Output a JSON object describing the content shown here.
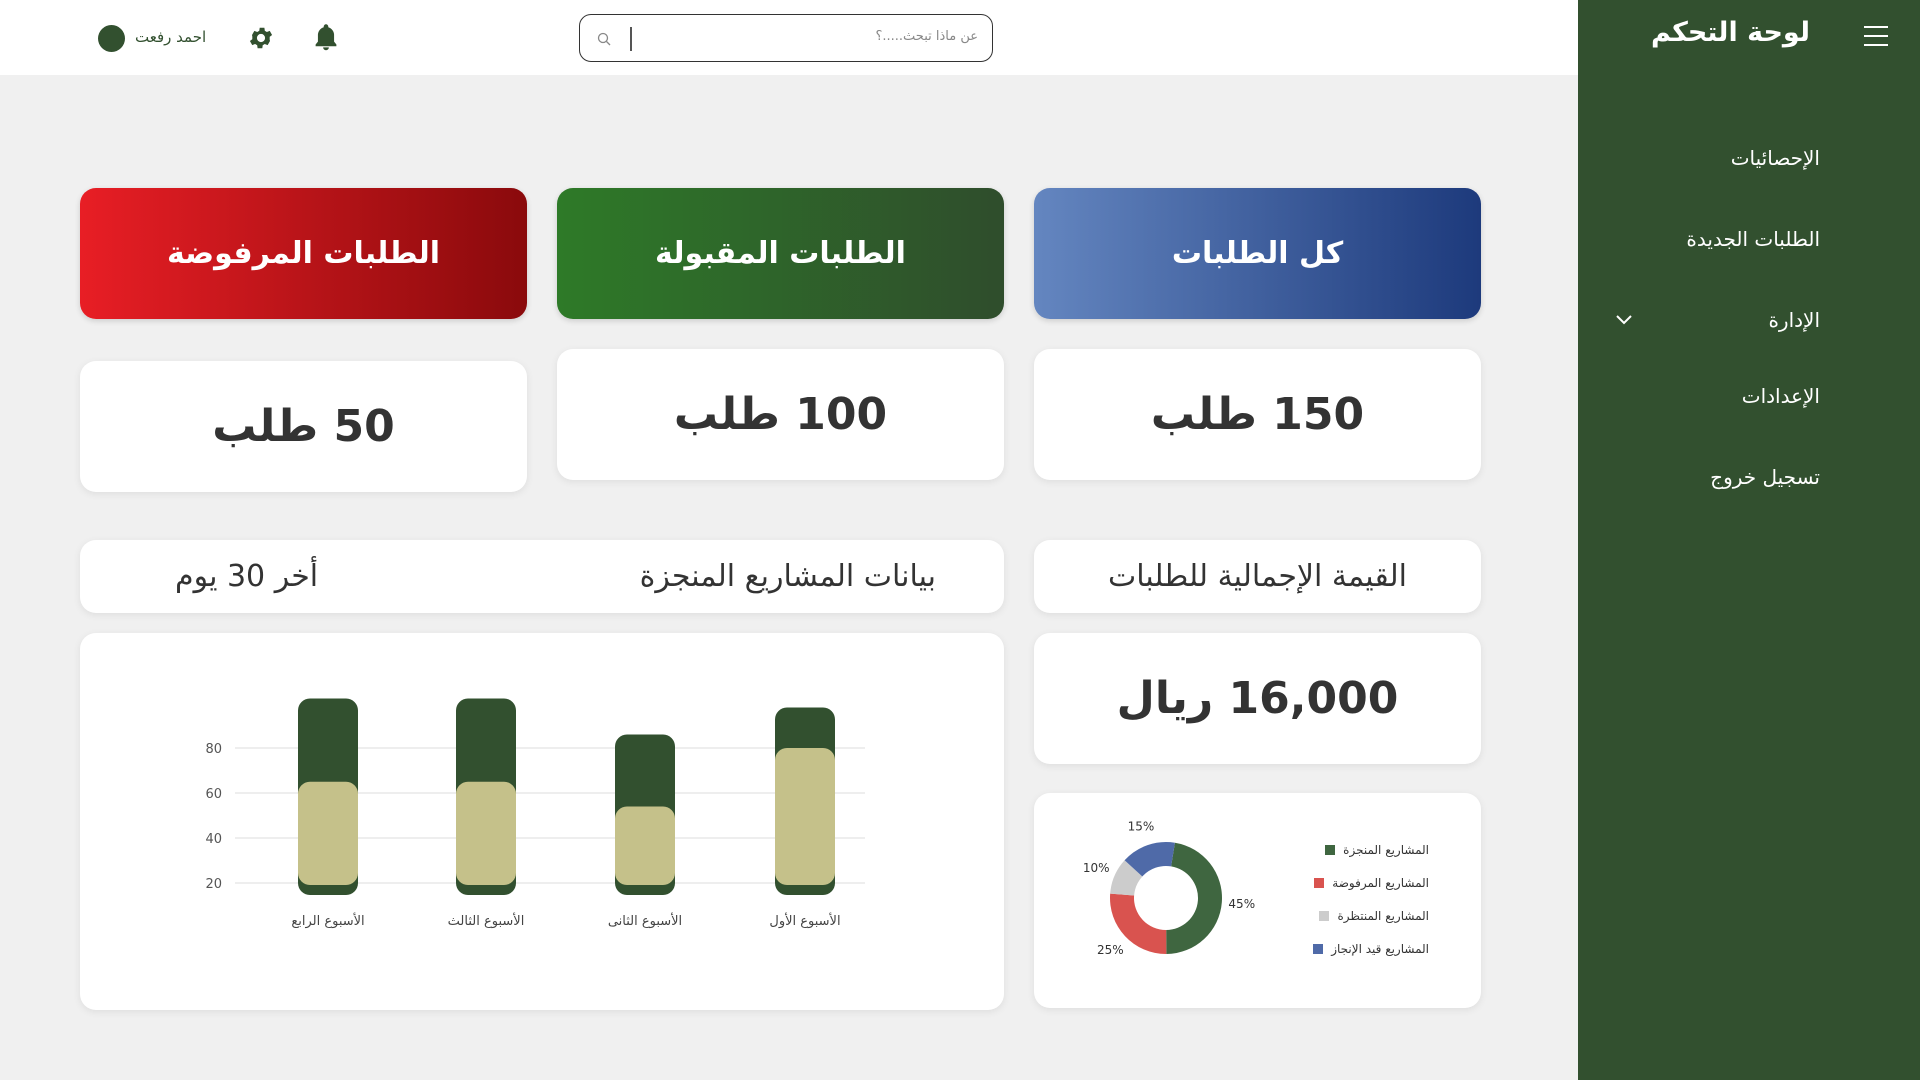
{
  "sidebar": {
    "title": "لوحة التحكم",
    "items": [
      {
        "label": "الإحصائيات"
      },
      {
        "label": "الطلبات الجديدة"
      },
      {
        "label": "الإدارة"
      },
      {
        "label": "الإعدادات"
      },
      {
        "label": "تسجيل خروج"
      }
    ]
  },
  "topbar": {
    "search_placeholder": "عن ماذا تبحث.....؟",
    "user_name": "احمد رفعت"
  },
  "cards": {
    "all": {
      "title": "كل الطلبات",
      "value": "150 طلب"
    },
    "accepted": {
      "title": "الطلبات المقبولة",
      "value": "100 طلب"
    },
    "rejected": {
      "title": "الطلبات المرفوضة",
      "value": "50 طلب"
    }
  },
  "total": {
    "title": "القيمة الإجمالية للطلبات",
    "value": "16,000 ريال"
  },
  "projects": {
    "title": "بيانات  المشاريع المنجزة",
    "period": "أخر 30 يوم"
  },
  "colors": {
    "dark_green": "#32502f",
    "khaki": "#c5c18a",
    "red": "#d9534f",
    "gray": "#cccccc",
    "blue": "#4f6aa8"
  },
  "chart_data": [
    {
      "type": "bar",
      "categories": [
        "الأسبوع الأول",
        "الأسبوع الثانى",
        "الأسبوع الثالث",
        "الأسبوع الرابع"
      ],
      "yticks": [
        20,
        40,
        60,
        80
      ],
      "ylim": [
        20,
        80
      ],
      "series": [
        {
          "values": [
            80,
            54,
            65,
            65
          ],
          "color": "#c5c18a"
        },
        {
          "values": [
            98,
            86,
            102,
            102
          ],
          "color": "#32502f"
        }
      ],
      "grid": true
    },
    {
      "type": "pie",
      "slices": [
        {
          "label": "المشاريع المنجزة",
          "value": 45,
          "text": "45%",
          "color": "#3f6640"
        },
        {
          "label": "المشاريع المرفوضة",
          "value": 25,
          "text": "25%",
          "color": "#d9534f"
        },
        {
          "label": "المشاريع المنتظرة",
          "value": 10,
          "text": "10%",
          "color": "#cccccc"
        },
        {
          "label": "المشاريع قيد الإنجاز",
          "value": 15,
          "text": "15%",
          "color": "#4f6aa8"
        }
      ]
    }
  ]
}
